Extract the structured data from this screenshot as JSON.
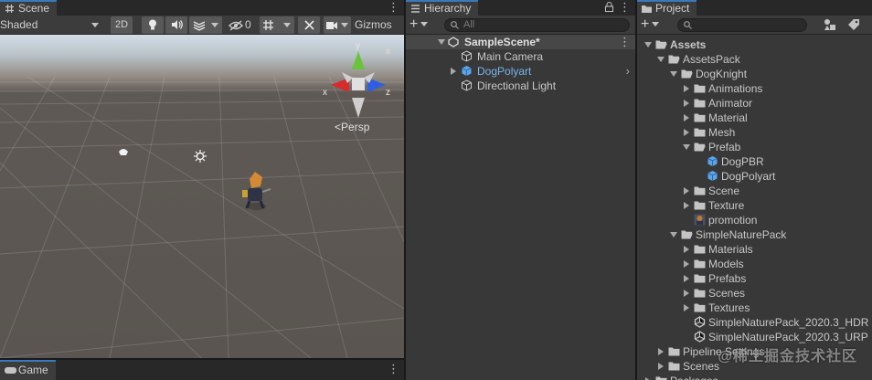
{
  "scene": {
    "tab_label": "Scene",
    "shading_mode": "Shaded",
    "toolbar": {
      "twod_label": "2D",
      "hidden_count": "0",
      "gizmos_label": "Gizmos"
    },
    "gizmo": {
      "y_label": "y",
      "x_label": "x",
      "z_label": "z",
      "projection_label": "Persp"
    }
  },
  "game": {
    "tab_label": "Game"
  },
  "hierarchy": {
    "tab_label": "Hierarchy",
    "search_placeholder": "All",
    "scene_name": "SampleScene*",
    "items": [
      {
        "label": "Main Camera",
        "icon": "gameobject-icon"
      },
      {
        "label": "DogPolyart",
        "icon": "prefab-cube-icon",
        "color": "#7ab3ee"
      },
      {
        "label": "Directional Light",
        "icon": "gameobject-icon"
      }
    ]
  },
  "project": {
    "tab_label": "Project",
    "tree": [
      {
        "label": "Assets",
        "type": "folder"
      },
      {
        "label": "AssetsPack",
        "type": "folder"
      },
      {
        "label": "DogKnight",
        "type": "folder"
      },
      {
        "label": "Animations",
        "type": "folder"
      },
      {
        "label": "Animator",
        "type": "folder"
      },
      {
        "label": "Material",
        "type": "folder"
      },
      {
        "label": "Mesh",
        "type": "folder"
      },
      {
        "label": "Prefab",
        "type": "folder"
      },
      {
        "label": "DogPBR",
        "type": "prefab"
      },
      {
        "label": "DogPolyart",
        "type": "prefab"
      },
      {
        "label": "Scene",
        "type": "folder"
      },
      {
        "label": "Texture",
        "type": "folder"
      },
      {
        "label": "promotion",
        "type": "image"
      },
      {
        "label": "SimpleNaturePack",
        "type": "folder"
      },
      {
        "label": "Materials",
        "type": "folder"
      },
      {
        "label": "Models",
        "type": "folder"
      },
      {
        "label": "Prefabs",
        "type": "folder"
      },
      {
        "label": "Scenes",
        "type": "folder"
      },
      {
        "label": "Textures",
        "type": "folder"
      },
      {
        "label": "SimpleNaturePack_2020.3_HDR",
        "type": "unity-icon"
      },
      {
        "label": "SimpleNaturePack_2020.3_URP",
        "type": "unity-icon"
      },
      {
        "label": "Pipeline Settings",
        "type": "folder"
      },
      {
        "label": "Scenes",
        "type": "folder"
      },
      {
        "label": "Packages",
        "type": "folder"
      }
    ]
  },
  "watermark": "@稀土掘金技术社区",
  "colors": {
    "accent_tab": "#3a79bb",
    "prefab_blue": "#7ab3ee",
    "gizmo_y": "#69c43a",
    "gizmo_x": "#d62c2c",
    "gizmo_z": "#2f5fe0"
  }
}
